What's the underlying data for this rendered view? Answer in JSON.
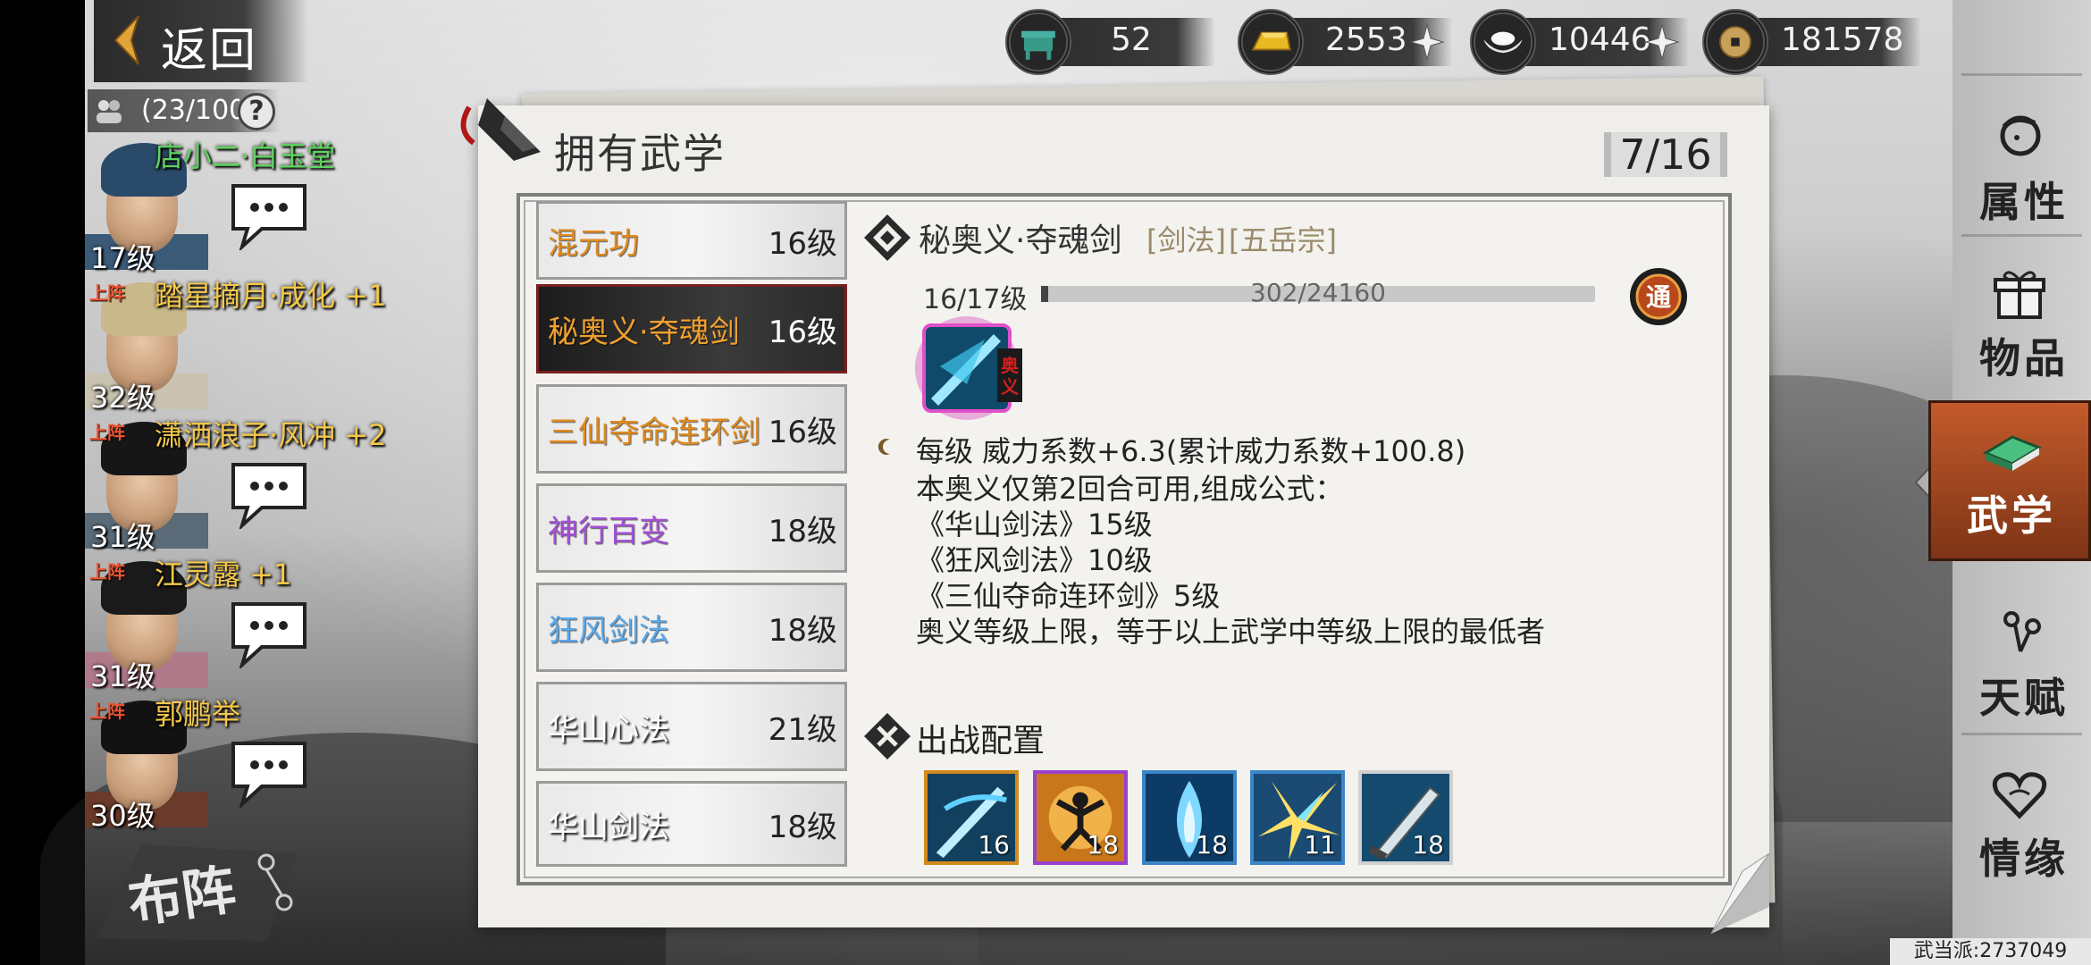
{
  "top_bar": {
    "back_label": "返回",
    "troop_count": "(23/100",
    "help_symbol": "?",
    "currencies": [
      {
        "name": "stamina",
        "icon": "ding-icon",
        "value": "52"
      },
      {
        "name": "gold",
        "icon": "gold-bar-icon",
        "value": "2553"
      },
      {
        "name": "silver",
        "icon": "silver-ingot-icon",
        "value": "10446"
      },
      {
        "name": "copper",
        "icon": "copper-coin-icon",
        "value": "181578"
      }
    ]
  },
  "characters": [
    {
      "name": "店小二·白玉堂",
      "level": "17级",
      "deployed": false,
      "deploy_tag": "",
      "name_color": "#5fd35f"
    },
    {
      "name": "踏星摘月·成化 +1",
      "level": "32级",
      "deployed": true,
      "deploy_tag": "上阵",
      "name_color": "#f5c84a"
    },
    {
      "name": "潇洒浪子·风冲 +2",
      "level": "31级",
      "deployed": true,
      "deploy_tag": "上阵",
      "name_color": "#f5c84a"
    },
    {
      "name": "江灵露 +1",
      "level": "31级",
      "deployed": true,
      "deploy_tag": "上阵",
      "name_color": "#f5c84a"
    },
    {
      "name": "郭鹏举",
      "level": "30级",
      "deployed": true,
      "deploy_tag": "上阵",
      "name_color": "#f5c84a"
    }
  ],
  "formation_label": "布阵",
  "panel": {
    "title": "拥有武学",
    "page": "7/16"
  },
  "skills": [
    {
      "name": "混元功",
      "level": "16级",
      "color": "#e08a1e",
      "selected": false
    },
    {
      "name": "秘奥义·夺魂剑",
      "level": "16级",
      "color": "#f0a030",
      "selected": true
    },
    {
      "name": "三仙夺命连环剑",
      "level": "16级",
      "color": "#e08a1e",
      "selected": false
    },
    {
      "name": "神行百变",
      "level": "18级",
      "color": "#a34fd6",
      "selected": false
    },
    {
      "name": "狂风剑法",
      "level": "18级",
      "color": "#3a90d9",
      "selected": false
    },
    {
      "name": "华山心法",
      "level": "21级",
      "color": "#ffffff",
      "selected": false
    },
    {
      "name": "华山剑法",
      "level": "18级",
      "color": "#ffffff",
      "selected": false
    }
  ],
  "detail": {
    "name": "秘奥义·夺魂剑",
    "tag_type": "[剑法]",
    "tag_sect": "[五岳宗]",
    "level_text": "16/17级",
    "exp_text": "302/24160",
    "exp_fraction": 0.0125,
    "badge": "通",
    "lines": [
      "每级    威力系数+6.3(累计威力系数+100.8)",
      "本奥义仅第2回合可用,组成公式：",
      "《华山剑法》15级",
      "《狂风剑法》10级",
      "《三仙夺命连环剑》5级",
      "奥义等级上限，等于以上武学中等级上限的最低者"
    ]
  },
  "battle_config": {
    "title": "出战配置",
    "skills": [
      {
        "level": "16",
        "border": "#d18a1a",
        "art": "sword-slash-icon"
      },
      {
        "level": "18",
        "border": "#9b3fd0",
        "art": "leaping-figure-icon"
      },
      {
        "level": "18",
        "border": "#3a86c8",
        "art": "blue-flame-icon"
      },
      {
        "level": "11",
        "border": "#3a86c8",
        "art": "golden-burst-icon"
      },
      {
        "level": "18",
        "border": "#d0d0d0",
        "art": "blade-icon"
      }
    ]
  },
  "sidebar": [
    {
      "label": "属性",
      "icon": "character-head-icon",
      "active": false
    },
    {
      "label": "物品",
      "icon": "gift-box-icon",
      "active": false
    },
    {
      "label": "武学",
      "icon": "book-icon",
      "active": true
    },
    {
      "label": "天赋",
      "icon": "talent-icon",
      "active": false
    },
    {
      "label": "情缘",
      "icon": "heart-icon",
      "active": false
    }
  ],
  "footer_id": "武当派:2737049"
}
